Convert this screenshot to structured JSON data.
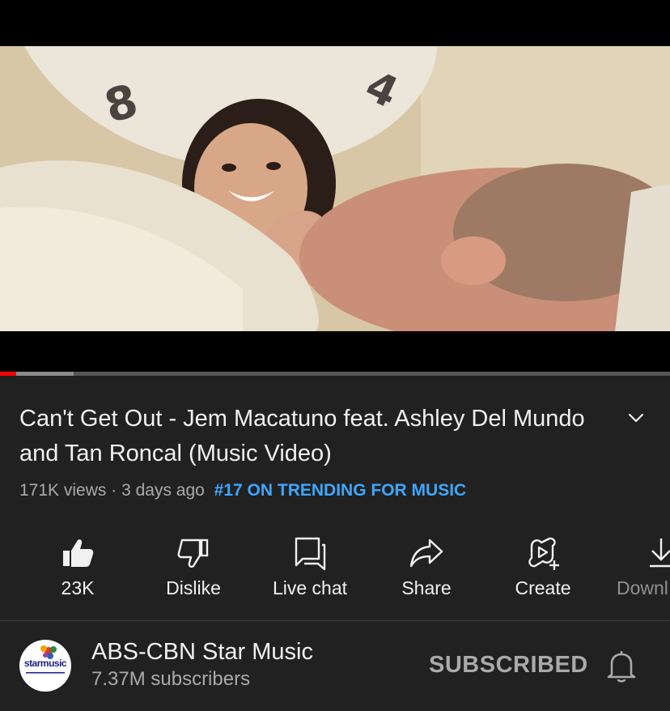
{
  "video": {
    "title": "Can't Get Out - Jem Macatuno feat. Ashley Del Mundo and Tan Roncal (Music Video)",
    "views": "171K views",
    "age": "3 days ago",
    "separator": "·",
    "trending": "#17 ON TRENDING FOR MUSIC",
    "progress_fraction": 0.024,
    "buffered_fraction": 0.11,
    "frame_numerals": [
      "8",
      "4"
    ]
  },
  "actions": [
    {
      "id": "like",
      "label": "23K",
      "icon": "thumbs-up-icon"
    },
    {
      "id": "dislike",
      "label": "Dislike",
      "icon": "thumbs-down-icon"
    },
    {
      "id": "live-chat",
      "label": "Live chat",
      "icon": "chat-icon"
    },
    {
      "id": "share",
      "label": "Share",
      "icon": "share-icon"
    },
    {
      "id": "create",
      "label": "Create",
      "icon": "create-icon"
    },
    {
      "id": "download",
      "label": "Downl",
      "icon": "download-icon"
    }
  ],
  "channel": {
    "name": "ABS-CBN Star Music",
    "subscribers": "7.37M subscribers",
    "subscribe_label": "SUBSCRIBED",
    "avatar_text": "starmusic"
  },
  "colors": {
    "background": "#212121",
    "progress_played": "#ff0000",
    "trending_link": "#3ea6ff",
    "secondary_text": "#aaaaaa"
  }
}
